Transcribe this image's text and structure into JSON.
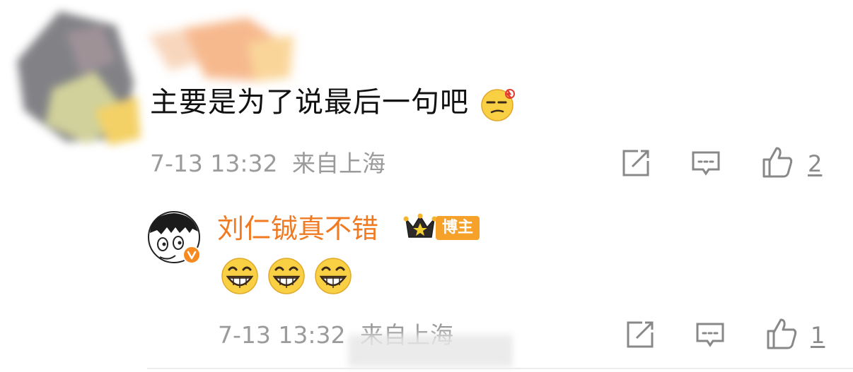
{
  "comment": {
    "text": "主要是为了说最后一句吧",
    "emoji_icon": "smirk-emoji-icon",
    "timestamp": "7-13 13:32",
    "location": "来自上海",
    "like_count": "2"
  },
  "reply": {
    "author_name": "刘仁铖真不错",
    "author_badge": "博主",
    "emojis": [
      "grin-emoji-icon",
      "grin-emoji-icon",
      "grin-emoji-icon"
    ],
    "timestamp": "7-13 13:32",
    "location": "来自上海",
    "like_count": "1"
  },
  "colors": {
    "author_name": "#f07a22",
    "badge_bg": "#f5a12a",
    "meta_text": "#9b9b9b"
  }
}
